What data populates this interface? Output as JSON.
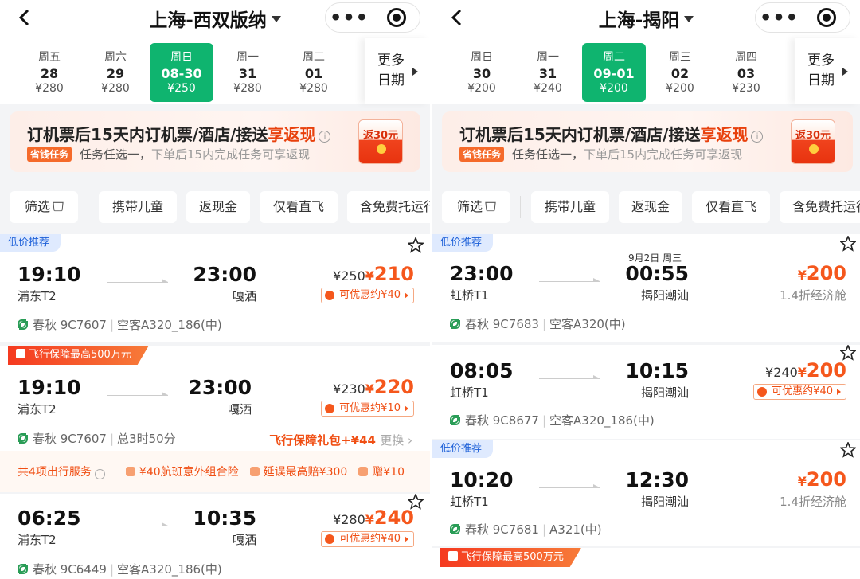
{
  "left": {
    "title": "上海-西双版纳",
    "dates": [
      {
        "weekday": "周五",
        "date": "28",
        "price": "¥280"
      },
      {
        "weekday": "周六",
        "date": "29",
        "price": "¥280"
      },
      {
        "weekday": "周日",
        "date": "08-30",
        "price": "¥250"
      },
      {
        "weekday": "周一",
        "date": "31",
        "price": "¥280"
      },
      {
        "weekday": "周二",
        "date": "01",
        "price": "¥280"
      }
    ],
    "more_dates": "更多日期",
    "promo": {
      "line1_prefix": "订机票后15天内订机票/酒店/接送",
      "line1_highlight": "享返现",
      "tag": "省钱任务",
      "line2_main": "任务任选一，",
      "line2_sub": "下单后15内完成任务可享返现",
      "envelope": "返30元"
    },
    "filters": [
      "筛选",
      "携带儿童",
      "返现金",
      "仅看直飞",
      "含免费托运行"
    ],
    "flights": [
      {
        "badge": "低价推荐",
        "dep_time": "19:10",
        "dep_airport": "浦东T2",
        "arr_time": "23:00",
        "arr_airport": "嘎洒",
        "old_price": "¥250",
        "yen": "¥",
        "price": "210",
        "discount": "可优惠约¥40",
        "airline": "春秋 9C7607",
        "aircraft": "空客A320_186(中)"
      },
      {
        "badge": "飞行保障最高500万元",
        "dep_time": "19:10",
        "dep_airport": "浦东T2",
        "arr_time": "23:00",
        "arr_airport": "嘎洒",
        "old_price": "¥230",
        "yen": "¥",
        "price": "220",
        "discount": "可优惠约¥10",
        "airline": "春秋 9C7607",
        "aircraft": "总3时50分",
        "pack": "飞行保障礼包+¥44",
        "pack_change": "更换",
        "services_title": "共4项出行服务",
        "services": [
          "¥40航班意外组合险",
          "延误最高赔¥300",
          "赠¥10"
        ]
      },
      {
        "dep_time": "06:25",
        "dep_airport": "浦东T2",
        "arr_time": "10:35",
        "arr_airport": "嘎洒",
        "old_price": "¥280",
        "yen": "¥",
        "price": "240",
        "discount": "可优惠约¥40",
        "airline": "春秋 9C6449",
        "aircraft": "空客A320_186(中)"
      }
    ]
  },
  "right": {
    "title": "上海-揭阳",
    "dates": [
      {
        "weekday": "周日",
        "date": "30",
        "price": "¥200"
      },
      {
        "weekday": "周一",
        "date": "31",
        "price": "¥240"
      },
      {
        "weekday": "周二",
        "date": "09-01",
        "price": "¥200"
      },
      {
        "weekday": "周三",
        "date": "02",
        "price": "¥200"
      },
      {
        "weekday": "周四",
        "date": "03",
        "price": "¥230"
      }
    ],
    "more_dates": "更多日期",
    "promo": {
      "line1_prefix": "订机票后15天内订机票/酒店/接送",
      "line1_highlight": "享返现",
      "tag": "省钱任务",
      "line2_main": "任务任选一，",
      "line2_sub": "下单后15内完成任务可享返现",
      "envelope": "返30元"
    },
    "filters": [
      "筛选",
      "携带儿童",
      "返现金",
      "仅看直飞",
      "含免费托运行"
    ],
    "flights": [
      {
        "badge": "低价推荐",
        "dep_time": "23:00",
        "dep_airport": "虹桥T1",
        "next_day": "9月2日 周三",
        "arr_time": "00:55",
        "arr_airport": "揭阳潮汕",
        "yen": "¥",
        "price": "200",
        "cabin": "1.4折经济舱",
        "airline": "春秋 9C7683",
        "aircraft": "空客A320(中)"
      },
      {
        "dep_time": "08:05",
        "dep_airport": "虹桥T1",
        "arr_time": "10:15",
        "arr_airport": "揭阳潮汕",
        "old_price": "¥240",
        "yen": "¥",
        "price": "200",
        "discount": "可优惠约¥40",
        "airline": "春秋 9C8677",
        "aircraft": "空客A320_186(中)"
      },
      {
        "badge": "低价推荐",
        "dep_time": "10:20",
        "dep_airport": "虹桥T1",
        "arr_time": "12:30",
        "arr_airport": "揭阳潮汕",
        "yen": "¥",
        "price": "200",
        "cabin": "1.4折经济舱",
        "airline": "春秋 9C7681",
        "aircraft": "A321(中)"
      },
      {
        "badge": "飞行保障最高500万元"
      }
    ]
  },
  "colors": {
    "accent_green": "#0fb46f",
    "price_orange": "#f5571c",
    "badge_blue": "#1d60d8"
  }
}
